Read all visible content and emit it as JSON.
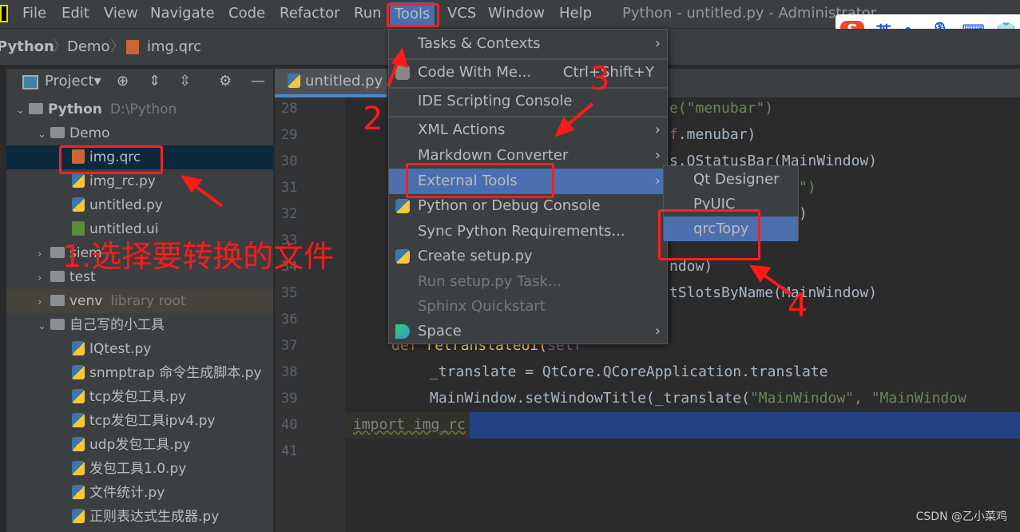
{
  "menubar": {
    "items": [
      "File",
      "Edit",
      "View",
      "Navigate",
      "Code",
      "Refactor",
      "Run",
      "Tools",
      "VCS",
      "Window",
      "Help"
    ],
    "active": "Tools",
    "window_title": "Python - untitled.py - Administrator"
  },
  "breadcrumb": [
    "Python",
    "Demo",
    "img.qrc"
  ],
  "project_panel": {
    "title": "Project"
  },
  "tree": [
    {
      "label": "Python",
      "hint": "D:\\Python",
      "type": "folder",
      "depth": 0,
      "expanded": true
    },
    {
      "label": "Demo",
      "type": "folder",
      "depth": 1,
      "expanded": true
    },
    {
      "label": "img.qrc",
      "type": "qrc",
      "depth": 2,
      "selected": true
    },
    {
      "label": "img_rc.py",
      "type": "py",
      "depth": 2
    },
    {
      "label": "untitled.py",
      "type": "py",
      "depth": 2
    },
    {
      "label": "untitled.ui",
      "type": "ui",
      "depth": 2
    },
    {
      "label": "siem",
      "type": "folder",
      "depth": 1,
      "expanded": false
    },
    {
      "label": "test",
      "type": "folder",
      "depth": 1,
      "expanded": false
    },
    {
      "label": "venv",
      "hint": "library root",
      "type": "folder",
      "depth": 1,
      "expanded": false
    },
    {
      "label": "自己写的小工具",
      "type": "folder",
      "depth": 1,
      "expanded": true
    },
    {
      "label": "IQtest.py",
      "type": "py",
      "depth": 2
    },
    {
      "label": "snmptrap 命令生成脚本.py",
      "type": "py",
      "depth": 2
    },
    {
      "label": "tcp发包工具.py",
      "type": "py",
      "depth": 2
    },
    {
      "label": "tcp发包工具ipv4.py",
      "type": "py",
      "depth": 2
    },
    {
      "label": "udp发包工具.py",
      "type": "py",
      "depth": 2
    },
    {
      "label": "发包工具1.0.py",
      "type": "py",
      "depth": 2
    },
    {
      "label": "文件统计.py",
      "type": "py",
      "depth": 2
    },
    {
      "label": "正则表达式生成器.py",
      "type": "py",
      "depth": 2
    }
  ],
  "editor": {
    "tab": "untitled.py",
    "line_numbers": [
      "28",
      "29",
      "30",
      "31",
      "32",
      "33",
      "34",
      "35",
      "36",
      "37",
      "38",
      "39",
      "40",
      "41"
    ],
    "visible_code": {
      "l28": "e(\"menubar\")",
      "l29a": "f",
      ".l29b": ".menubar)",
      "l30": "s.QStatusBar(MainWindow)",
      "l31": "\")",
      "l32": ")",
      "l34": "ndow)",
      "l35": "tSlotsByName(MainWindow)",
      "l37a": "def ",
      "l37b": "retranslateUi(",
      "l37c": "self",
      ",l37d": ", MainWindow):",
      "l38": "_translate = QtCore.QCoreApplication.translate",
      "l39a": "MainWindow.setWindowTitle(_translate(",
      "l39b": "\"MainWindow\"",
      ",l39c": ", ",
      "l39d": "\"MainWindow",
      "l40": "import img_rc"
    }
  },
  "tools_menu": [
    {
      "label": "Tasks & Contexts",
      "submenu": true
    },
    {
      "label": "Code With Me...",
      "shortcut": "Ctrl+Shift+Y",
      "icon": "users-icon"
    },
    {
      "label": "IDE Scripting Console"
    },
    {
      "label": "XML Actions",
      "submenu": true
    },
    {
      "label": "Markdown Converter",
      "submenu": true
    },
    {
      "label": "External Tools",
      "submenu": true,
      "highlighted": true
    },
    {
      "label": "Python or Debug Console",
      "icon": "python-icon"
    },
    {
      "label": "Sync Python Requirements..."
    },
    {
      "label": "Create setup.py",
      "icon": "python-file-icon"
    },
    {
      "label": "Run setup.py Task...",
      "disabled": true
    },
    {
      "label": "Sphinx Quickstart",
      "disabled": true
    },
    {
      "label": "Space",
      "submenu": true,
      "icon": "space-icon"
    }
  ],
  "external_tools_submenu": [
    {
      "label": "Qt Designer"
    },
    {
      "label": "PyUIC"
    },
    {
      "label": "qrcTopy",
      "highlighted": true
    }
  ],
  "annotations": {
    "step1": "1.选择要转换的文件",
    "step2": "2",
    "step3": "3",
    "step4": "4",
    "color": "#ff1a1a"
  },
  "ime": {
    "logo": "S",
    "lang": "英",
    "punct": "•,"
  },
  "watermark": "CSDN @乙小菜鸡",
  "colors": {
    "accent": "#4b6eaf",
    "selection": "#0d293e",
    "menu_bg": "#3c3f41",
    "editor_bg": "#2b2b2b"
  }
}
